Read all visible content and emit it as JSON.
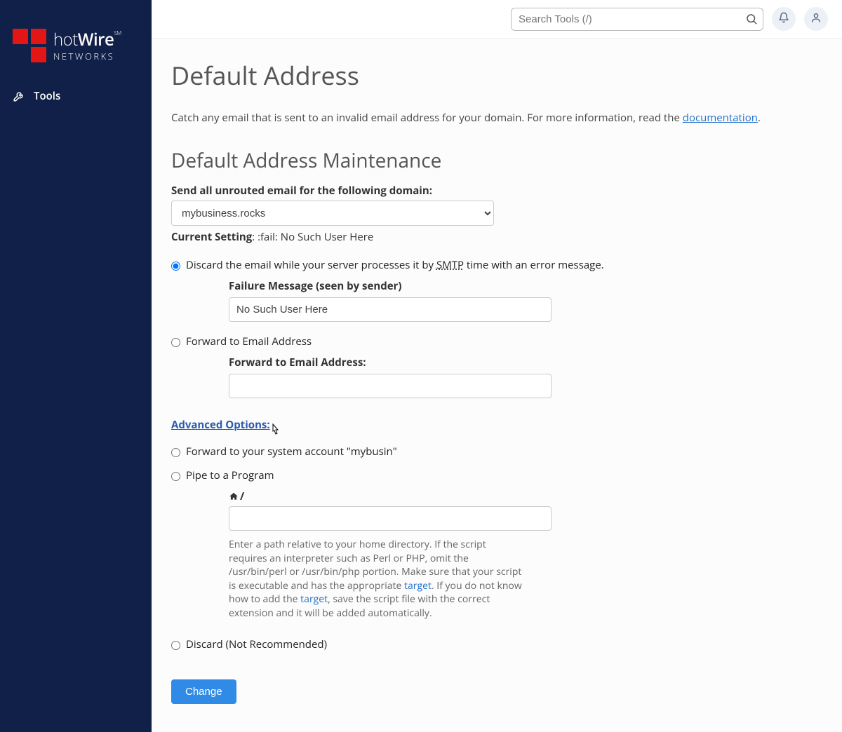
{
  "brand": {
    "line1_a": "hot",
    "line1_b": "Wire",
    "sm": "SM",
    "line2": "NETWORKS"
  },
  "sidebar": {
    "tools_label": "Tools"
  },
  "topbar": {
    "search_placeholder": "Search Tools (/)"
  },
  "page": {
    "title": "Default Address",
    "intro_a": "Catch any email that is sent to an invalid email address for your domain. For more information, read the ",
    "intro_link": "documentation",
    "intro_dot": ".",
    "section_title": "Default Address Maintenance",
    "domain_label": "Send all unrouted email for the following domain:",
    "domain_value": "mybusiness.rocks",
    "current_setting_label": "Current Setting",
    "current_setting_value": ": :fail: No Such User Here",
    "opt_discard_a": "Discard the email while your server processes it by ",
    "opt_discard_smtp": "SMTP",
    "opt_discard_b": " time with an error message.",
    "failure_label": "Failure Message (seen by sender)",
    "failure_value": "No Such User Here",
    "opt_forward": "Forward to Email Address",
    "forward_label": "Forward to Email Address:",
    "advanced": "Advanced Options:",
    "opt_system": "Forward to your system account \"mybusin\"",
    "opt_pipe": "Pipe to a Program",
    "pipe_slash": "/",
    "pipe_help_a": "Enter a path relative to your home directory. If the script requires an interpreter such as Perl or PHP, omit the /usr/bin/perl or /usr/bin/php portion. Make sure that your script is executable and has the appropriate ",
    "pipe_help_link": "target",
    "pipe_help_b": ". If you do not know how to add the ",
    "pipe_help_link2": "target",
    "pipe_help_c": ", save the script file with the correct extension and it will be added automatically.",
    "opt_discard_nr": "Discard (Not Recommended)",
    "submit": "Change"
  }
}
